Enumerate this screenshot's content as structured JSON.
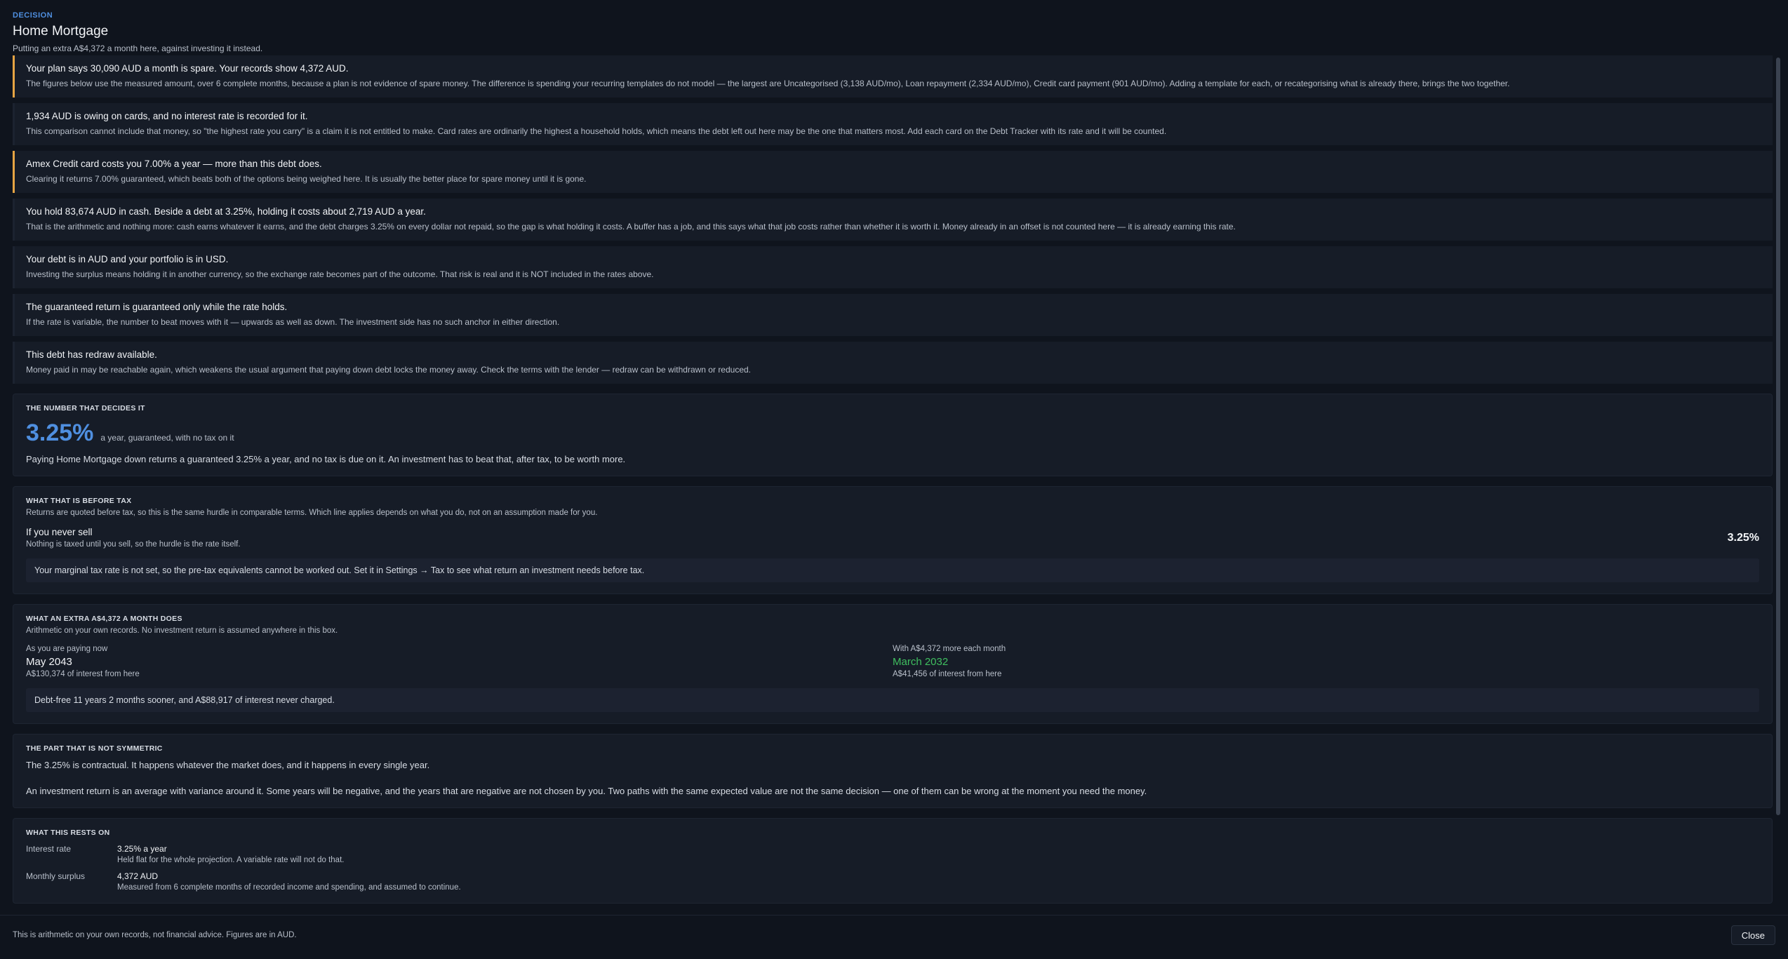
{
  "header": {
    "kicker": "DECISION",
    "title": "Home Mortgage",
    "subtitle": "Putting an extra A$4,372 a month here, against investing it instead."
  },
  "notices": [
    {
      "severity": "warning",
      "headline": "Your plan says 30,090 AUD a month is spare. Your records show 4,372 AUD.",
      "body": "The figures below use the measured amount, over 6 complete months, because a plan is not evidence of spare money. The difference is spending your recurring templates do not model — the largest are Uncategorised (3,138 AUD/mo), Loan repayment (2,334 AUD/mo), Credit card payment (901 AUD/mo). Adding a template for each, or recategorising what is already there, brings the two together."
    },
    {
      "severity": "info",
      "headline": "1,934 AUD is owing on cards, and no interest rate is recorded for it.",
      "body": "This comparison cannot include that money, so \"the highest rate you carry\" is a claim it is not entitled to make. Card rates are ordinarily the highest a household holds, which means the debt left out here may be the one that matters most. Add each card on the Debt Tracker with its rate and it will be counted."
    },
    {
      "severity": "warning",
      "headline": "Amex Credit card costs you 7.00% a year — more than this debt does.",
      "body": "Clearing it returns 7.00% guaranteed, which beats both of the options being weighed here. It is usually the better place for spare money until it is gone."
    },
    {
      "severity": "info",
      "headline": "You hold 83,674 AUD in cash. Beside a debt at 3.25%, holding it costs about 2,719 AUD a year.",
      "body": "That is the arithmetic and nothing more: cash earns whatever it earns, and the debt charges 3.25% on every dollar not repaid, so the gap is what holding it costs. A buffer has a job, and this says what that job costs rather than whether it is worth it. Money already in an offset is not counted here — it is already earning this rate."
    },
    {
      "severity": "info",
      "headline": "Your debt is in AUD and your portfolio is in USD.",
      "body": "Investing the surplus means holding it in another currency, so the exchange rate becomes part of the outcome. That risk is real and it is NOT included in the rates above."
    },
    {
      "severity": "info",
      "headline": "The guaranteed return is guaranteed only while the rate holds.",
      "body": "If the rate is variable, the number to beat moves with it — upwards as well as down. The investment side has no such anchor in either direction."
    },
    {
      "severity": "info",
      "headline": "This debt has redraw available.",
      "body": "Money paid in may be reachable again, which weakens the usual argument that paying down debt locks the money away. Check the terms with the lender — redraw can be withdrawn or reduced."
    }
  ],
  "deciding_number": {
    "title": "THE NUMBER THAT DECIDES IT",
    "value": "3.25%",
    "note": "a year, guaranteed, with no tax on it",
    "text": "Paying Home Mortgage down returns a guaranteed 3.25% a year, and no tax is due on it. An investment has to beat that, after tax, to be worth more."
  },
  "before_tax": {
    "title": "WHAT THAT IS BEFORE TAX",
    "note": "Returns are quoted before tax, so this is the same hurdle in comparable terms. Which line applies depends on what you do, not on an assumption made for you.",
    "row_label": "If you never sell",
    "row_sub": "Nothing is taxed until you sell, so the hurdle is the rate itself.",
    "row_value": "3.25%",
    "message": "Your marginal tax rate is not set, so the pre-tax equivalents cannot be worked out. Set it in Settings → Tax to see what return an investment needs before tax."
  },
  "extra": {
    "title": "WHAT AN EXTRA A$4,372 A MONTH DOES",
    "note": "Arithmetic on your own records. No investment return is assumed anywhere in this box.",
    "left_label": "As you are paying now",
    "left_value": "May 2043",
    "left_sub": "A$130,374 of interest from here",
    "right_label": "With A$4,372 more each month",
    "right_value": "March 2032",
    "right_sub": "A$41,456 of interest from here",
    "summary": "Debt-free 11 years 2 months sooner, and A$88,917 of interest never charged."
  },
  "symmetric": {
    "title": "THE PART THAT IS NOT SYMMETRIC",
    "p1": "The 3.25% is contractual. It happens whatever the market does, and it happens in every single year.",
    "p2": "An investment return is an average with variance around it. Some years will be negative, and the years that are negative are not chosen by you. Two paths with the same expected value are not the same decision — one of them can be wrong at the moment you need the money."
  },
  "rests_on": {
    "title": "WHAT THIS RESTS ON",
    "items": [
      {
        "label": "Interest rate",
        "value": "3.25% a year",
        "note": "Held flat for the whole projection. A variable rate will not do that."
      },
      {
        "label": "Monthly surplus",
        "value": "4,372 AUD",
        "note": "Measured from 6 complete months of recorded income and spending, and assumed to continue."
      }
    ]
  },
  "footer": {
    "disclaimer": "This is arithmetic on your own records, not financial advice. Figures are in AUD.",
    "close_label": "Close"
  },
  "colors": {
    "accent": "#4f8fe0",
    "warning": "#e6a443",
    "positive": "#3fbf5f",
    "background": "#0f141d",
    "card": "#161c27"
  }
}
